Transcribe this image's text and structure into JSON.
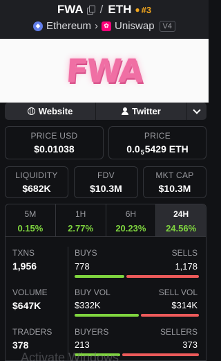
{
  "header": {
    "base": "FWA",
    "slash": "/",
    "quote": "ETH",
    "rank": "#3",
    "chain": "Ethereum",
    "dex": "Uniswap",
    "version": "V4"
  },
  "banner": {
    "logo_text": "FWA"
  },
  "links": {
    "website": "Website",
    "twitter": "Twitter"
  },
  "price": {
    "usd_label": "PRICE USD",
    "usd_value": "$0.01038",
    "native_label": "PRICE",
    "native_prefix": "0.0",
    "native_zeros": "5",
    "native_digits": "5429 ETH"
  },
  "metrics": {
    "liquidity_label": "LIQUIDITY",
    "liquidity_value": "$682K",
    "fdv_label": "FDV",
    "fdv_value": "$10.3M",
    "mktcap_label": "MKT CAP",
    "mktcap_value": "$10.3M"
  },
  "timeframes": [
    {
      "label": "5M",
      "value": "0.15%"
    },
    {
      "label": "1H",
      "value": "2.77%"
    },
    {
      "label": "6H",
      "value": "20.23%"
    },
    {
      "label": "24H",
      "value": "24.56%"
    }
  ],
  "active_timeframe": "24H",
  "stats": {
    "txns": {
      "label": "TXNS",
      "value": "1,956",
      "left_label": "BUYS",
      "left_value": "778",
      "right_label": "SELLS",
      "right_value": "1,178",
      "left_fraction": 0.398
    },
    "volume": {
      "label": "VOLUME",
      "value": "$647K",
      "left_label": "BUY VOL",
      "left_value": "$332K",
      "right_label": "SELL VOL",
      "right_value": "$314K",
      "left_fraction": 0.514
    },
    "traders": {
      "label": "TRADERS",
      "value": "378",
      "left_label": "BUYERS",
      "left_value": "213",
      "right_label": "SELLERS",
      "right_value": "373",
      "left_fraction": 0.364
    }
  },
  "overlay": {
    "watermark": "Activate Windows"
  },
  "colors": {
    "positive": "#7fd53f",
    "negative": "#ec5a5a",
    "rank": "#f0a51e",
    "logo_pink": "#f06fa4"
  }
}
